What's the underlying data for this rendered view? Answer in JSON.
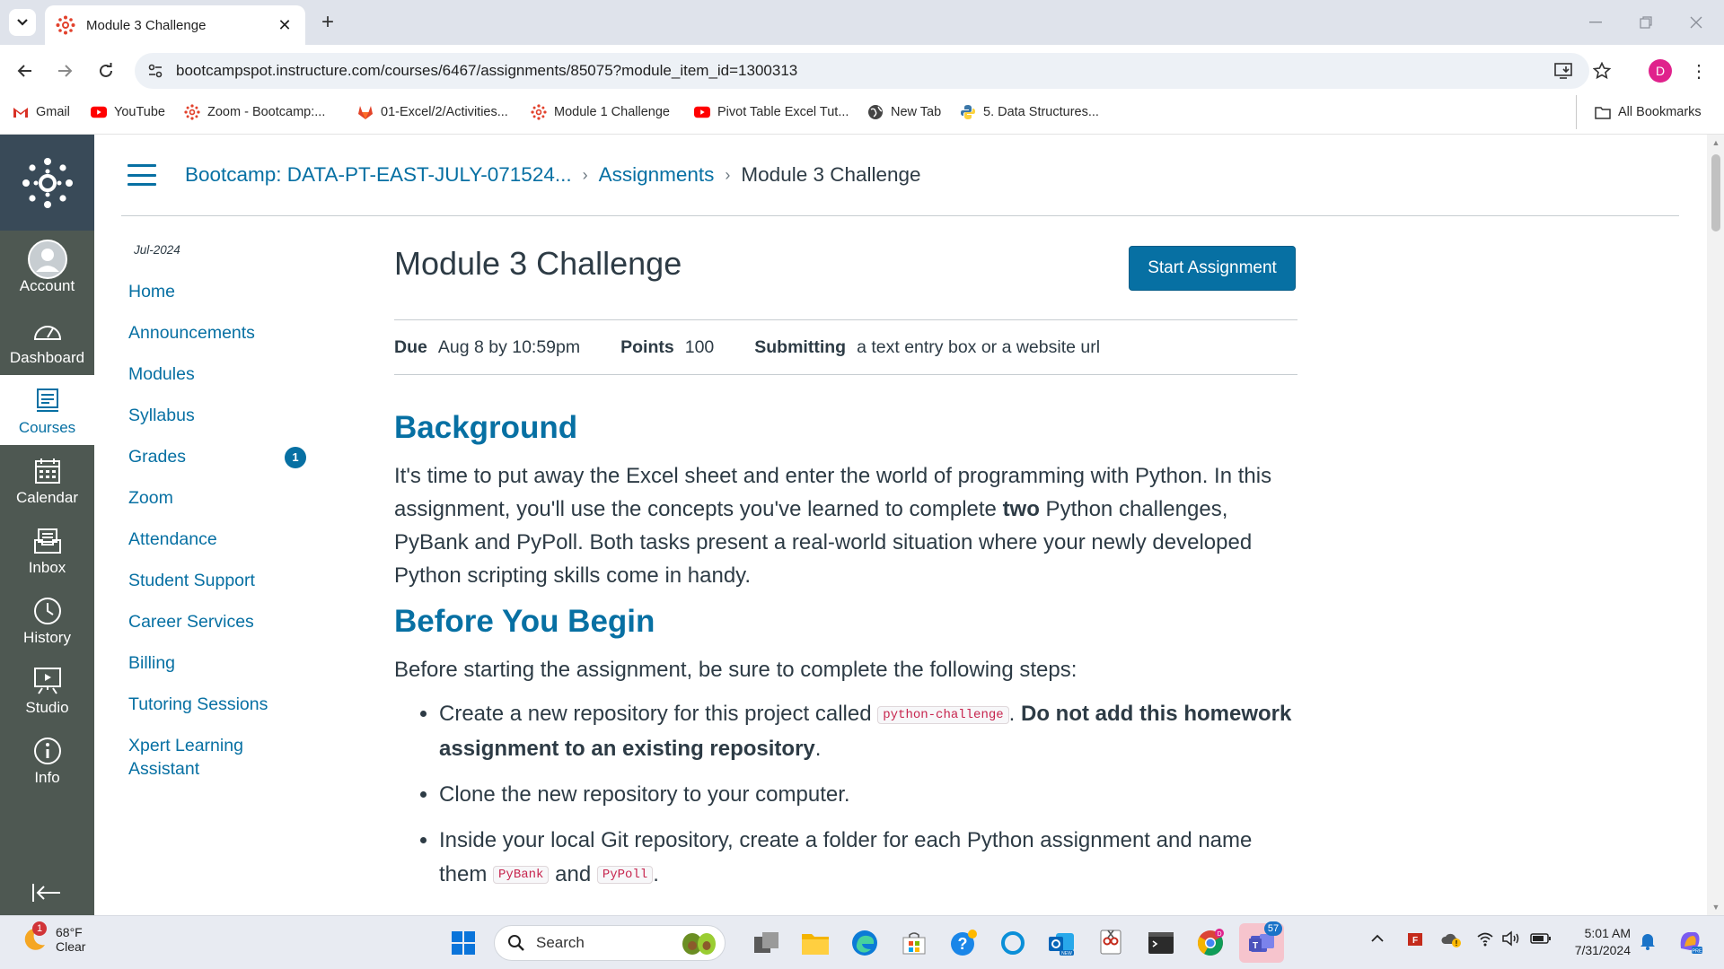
{
  "browser": {
    "tab_title": "Module 3 Challenge",
    "url": "bootcampspot.instructure.com/courses/6467/assignments/85075?module_item_id=1300313",
    "profile_initial": "D",
    "bookmarks": [
      {
        "label": "Gmail",
        "icon": "gmail-icon"
      },
      {
        "label": "YouTube",
        "icon": "youtube-icon"
      },
      {
        "label": "Zoom - Bootcamp:...",
        "icon": "canvas-icon"
      },
      {
        "label": "01-Excel/2/Activities...",
        "icon": "gitlab-icon"
      },
      {
        "label": "Module 1 Challenge",
        "icon": "canvas-icon"
      },
      {
        "label": "Pivot Table Excel Tut...",
        "icon": "youtube-icon"
      },
      {
        "label": "New Tab",
        "icon": "globe-icon"
      },
      {
        "label": "5. Data Structures...",
        "icon": "python-icon"
      }
    ],
    "all_bookmarks": "All Bookmarks"
  },
  "global_nav": {
    "items": [
      {
        "label": "Account",
        "icon": "account-icon"
      },
      {
        "label": "Dashboard",
        "icon": "dashboard-icon"
      },
      {
        "label": "Courses",
        "icon": "courses-icon",
        "active": true
      },
      {
        "label": "Calendar",
        "icon": "calendar-icon"
      },
      {
        "label": "Inbox",
        "icon": "inbox-icon"
      },
      {
        "label": "History",
        "icon": "history-icon"
      },
      {
        "label": "Studio",
        "icon": "studio-icon"
      },
      {
        "label": "Info",
        "icon": "info-icon"
      }
    ]
  },
  "breadcrumb": {
    "course": "Bootcamp: DATA-PT-EAST-JULY-071524...",
    "section": "Assignments",
    "current": "Module 3 Challenge"
  },
  "course_nav": {
    "term": "Jul-2024",
    "items": [
      {
        "label": "Home"
      },
      {
        "label": "Announcements"
      },
      {
        "label": "Modules"
      },
      {
        "label": "Syllabus"
      },
      {
        "label": "Grades",
        "badge": "1"
      },
      {
        "label": "Zoom"
      },
      {
        "label": "Attendance"
      },
      {
        "label": "Student Support"
      },
      {
        "label": "Career Services"
      },
      {
        "label": "Billing"
      },
      {
        "label": "Tutoring Sessions"
      },
      {
        "label": "Xpert Learning Assistant"
      }
    ]
  },
  "assignment": {
    "title": "Module 3 Challenge",
    "start_button": "Start Assignment",
    "due_label": "Due",
    "due_value": "Aug 8 by 10:59pm",
    "points_label": "Points",
    "points_value": "100",
    "submitting_label": "Submitting",
    "submitting_value": "a text entry box or a website url",
    "background_heading": "Background",
    "background_p1": "It's time to put away the Excel sheet and enter the world of programming with Python. In this assignment, you'll use the concepts you've learned to complete ",
    "background_bold": "two",
    "background_p2": " Python challenges, PyBank and PyPoll. Both tasks present a real-world situation where your newly developed Python scripting skills come in handy.",
    "before_heading": "Before You Begin",
    "before_intro": "Before starting the assignment, be sure to complete the following steps:",
    "step1_text": "Create a new repository for this project called ",
    "step1_code": "python-challenge",
    "step1_after": ". ",
    "step1_bold": "Do not add this homework assignment to an existing repository",
    "step1_end": ".",
    "step2_text": "Clone the new repository to your computer.",
    "step3_text": "Inside your local Git repository, create a folder for each Python assignment and name them ",
    "step3_code1": "PyBank",
    "step3_and": " and ",
    "step3_code2": "PyPoll",
    "step3_end": "."
  },
  "taskbar": {
    "temperature": "68°F",
    "condition": "Clear",
    "weather_badge": "1",
    "search_label": "Search",
    "teams_badge": "57",
    "time": "5:01 AM",
    "date": "7/31/2024"
  }
}
